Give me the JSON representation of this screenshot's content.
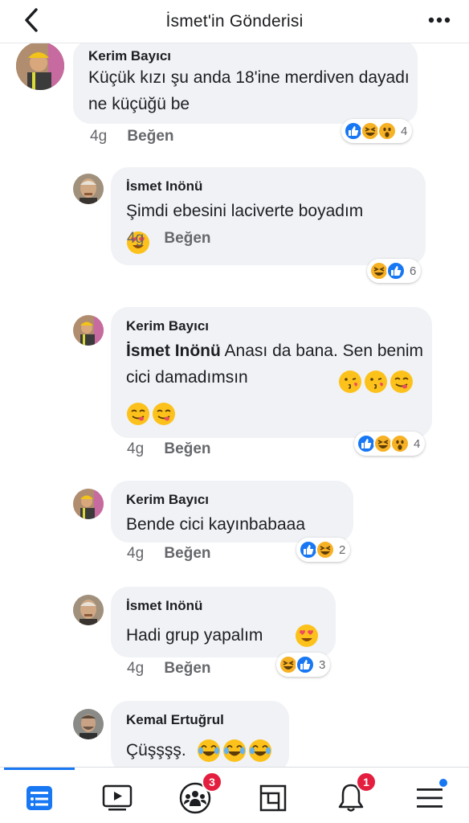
{
  "header": {
    "title": "İsmet'in Gönderisi",
    "back_icon": "chevron-left-icon",
    "more_icon": "more-dots-icon"
  },
  "comments": [
    {
      "author": "Kerim Bayıcı",
      "text": "Küçük kızı şu anda 18'ine merdiven dayadı ne küçüğü be",
      "time": "4g",
      "like": "Beğen",
      "reactions": [
        "like",
        "haha",
        "wow"
      ],
      "count": "4"
    },
    {
      "author": "İsmet Inönü",
      "text": "Şimdi ebesini laciverte boyadım",
      "emojis": [
        "heart-eyes"
      ],
      "time": "4g",
      "like": "Beğen",
      "reactions": [
        "haha",
        "like"
      ],
      "count": "6"
    },
    {
      "author": "Kerim Bayıcı",
      "mention": "İsmet Inönü",
      "text": "Anası da bana. Sen benim cici damadımsın",
      "emojis": [
        "kiss",
        "kiss",
        "yum",
        "yum",
        "yum"
      ],
      "time": "4g",
      "like": "Beğen",
      "reactions": [
        "like",
        "haha",
        "wow"
      ],
      "count": "4"
    },
    {
      "author": "Kerim Bayıcı",
      "text": "Bende cici kayınbabaaa",
      "time": "4g",
      "like": "Beğen",
      "reactions": [
        "like",
        "haha"
      ],
      "count": "2"
    },
    {
      "author": "İsmet Inönü",
      "text": "Hadi grup yapalım",
      "emojis": [
        "heart-eyes"
      ],
      "time": "4g",
      "like": "Beğen",
      "reactions": [
        "haha",
        "like"
      ],
      "count": "3"
    },
    {
      "author": "Kemal Ertuğrul",
      "text": "Çüşşşş.",
      "emojis": [
        "joy",
        "joy",
        "joy"
      ]
    }
  ],
  "tabbar": {
    "groups_badge": "3",
    "notifications_badge": "1"
  },
  "colors": {
    "accent": "#1877f2",
    "bubble": "#f0f2f5",
    "badge": "#e41e3f",
    "meta": "#65676b"
  }
}
